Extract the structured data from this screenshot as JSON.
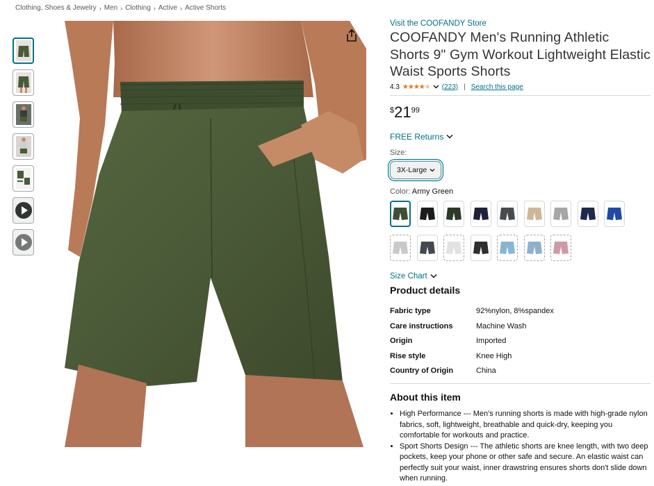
{
  "breadcrumb": [
    "Clothing, Shoes & Jewelry",
    "Men",
    "Clothing",
    "Active",
    "Active Shorts"
  ],
  "product": {
    "store_link": "Visit the COOFANDY Store",
    "title": "COOFANDY Men's Running Athletic Shorts 9\" Gym Workout Lightweight Elastic Waist Sports Shorts",
    "rating": "4.3",
    "rating_count": "(223)",
    "search_link": "Search this page",
    "price_symbol": "$",
    "price_whole": "21",
    "price_fraction": "99",
    "returns": "FREE Returns",
    "size_label": "Size:",
    "size_selected": "3X-Large",
    "color_label": "Color:",
    "color_selected": "Army Green",
    "size_chart": "Size Chart"
  },
  "swatches": [
    {
      "name": "Army Green",
      "color": "#3f4f33",
      "selected": true
    },
    {
      "name": "Black",
      "color": "#1b1b1b"
    },
    {
      "name": "Dark Green",
      "color": "#2c3a28"
    },
    {
      "name": "Navy Black",
      "color": "#1e2238"
    },
    {
      "name": "Dark Gray",
      "color": "#4a4b4d"
    },
    {
      "name": "Khaki",
      "color": "#cdb896"
    },
    {
      "name": "Light Gray",
      "color": "#a7a6a4"
    },
    {
      "name": "Navy",
      "color": "#1d2a4a"
    },
    {
      "name": "Royal Blue",
      "color": "#2049a6"
    },
    {
      "name": "Light Gray 2",
      "color": "#c9c9c9",
      "unavailable": true
    },
    {
      "name": "Gray Navy",
      "color": "#44484f"
    },
    {
      "name": "White",
      "color": "#e2e2e2",
      "unavailable": true
    },
    {
      "name": "Black Gray",
      "color": "#2e2e2e"
    },
    {
      "name": "Sky Blue",
      "color": "#87b6d3",
      "unavailable": true
    },
    {
      "name": "Light Blue",
      "color": "#8eb0cc",
      "unavailable": true
    },
    {
      "name": "Pink",
      "color": "#cf9aa3",
      "unavailable": true
    }
  ],
  "product_details": {
    "title": "Product details",
    "rows": [
      {
        "key": "Fabric type",
        "value": "92%nylon, 8%spandex"
      },
      {
        "key": "Care instructions",
        "value": "Machine Wash"
      },
      {
        "key": "Origin",
        "value": "Imported"
      },
      {
        "key": "Rise style",
        "value": "Knee High"
      },
      {
        "key": "Country of Origin",
        "value": "China"
      }
    ]
  },
  "about": {
    "title": "About this item",
    "bullets": [
      "High Performance --- Men's running shorts is made with high-grade nylon fabrics, soft, lightweight, breathable and quick-dry, keeping you comfortable for workouts and practice.",
      "Sport Shorts Design --- The athletic shorts are knee length, with two deep pockets, keep your phone or other safe and secure. An elastic waist can perfectly suit your waist, inner drawstring ensures shorts don't slide down when running."
    ]
  },
  "colors": {
    "link": "#007185",
    "star": "#de7921",
    "shorts": "#4b5a38",
    "skin": "#c58b67"
  },
  "icons": {
    "share": "share-icon",
    "chevron": "chevron-down-icon",
    "play": "play-icon"
  }
}
